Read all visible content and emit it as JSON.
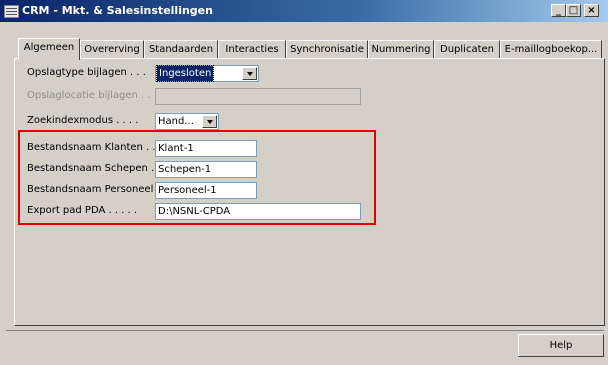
{
  "window": {
    "title": "CRM - Mkt. & Salesinstellingen",
    "controls": [
      "_",
      "□",
      "×"
    ]
  },
  "tabs": [
    {
      "label": "Algemeen",
      "active": true
    },
    {
      "label": "Overerving"
    },
    {
      "label": "Standaarden"
    },
    {
      "label": "Interacties"
    },
    {
      "label": "Synchronisatie"
    },
    {
      "label": "Nummering"
    },
    {
      "label": "Duplicaten"
    },
    {
      "label": "E-maillogboekop..."
    }
  ],
  "form": {
    "attachment_type": {
      "label": "Opslagtype bijlagen . . .",
      "value": "Ingesloten"
    },
    "attachment_location": {
      "label": "Opslaglocatie bijlagen . .",
      "value": ""
    },
    "search_index": {
      "label": "Zoekindexmodus . . . .",
      "value": "Hand..."
    },
    "customers_file": {
      "label": "Bestandsnaam Klanten . .",
      "value": "Klant-1"
    },
    "ships_file": {
      "label": "Bestandsnaam Schepen .",
      "value": "Schepen-1"
    },
    "personnel_file": {
      "label": "Bestandsnaam Personeel",
      "value": "Personeel-1"
    },
    "pda_path": {
      "label": "Export pad PDA . . . . .",
      "value": "D:\\NSNL-CPDA"
    }
  },
  "buttons": {
    "help": "Help"
  },
  "colors": {
    "title_bar": "#0a246a",
    "highlight_border": "#e00000"
  }
}
